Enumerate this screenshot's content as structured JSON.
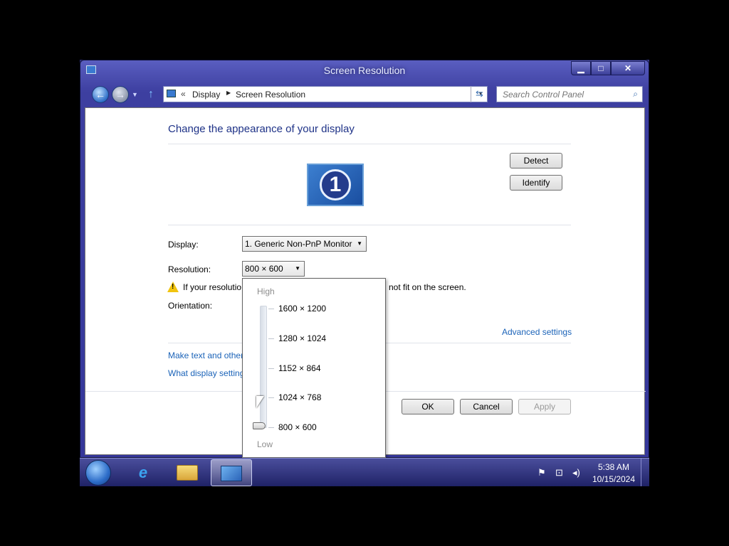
{
  "window": {
    "title": "Screen Resolution",
    "minimize_label": "▁",
    "maximize_label": "□",
    "close_label": "✕"
  },
  "nav": {
    "back_icon": "arrow-left-icon",
    "forward_icon": "arrow-right-icon",
    "breadcrumb": [
      "Display",
      "Screen Resolution"
    ],
    "search_placeholder": "Search Control Panel"
  },
  "main": {
    "heading": "Change the appearance of your display",
    "monitor_number": "1",
    "detect_label": "Detect",
    "identify_label": "Identify",
    "display_label": "Display:",
    "display_value": "1. Generic Non-PnP Monitor",
    "resolution_label": "Resolution:",
    "resolution_value": "800 × 600",
    "warning_prefix": "If your resolutio",
    "warning_suffix": "not fit on the screen.",
    "orientation_label": "Orientation:",
    "advanced_settings": "Advanced settings",
    "link_text_size": "Make text and other",
    "link_display_settings": "What display setting",
    "ok_label": "OK",
    "cancel_label": "Cancel",
    "apply_label": "Apply"
  },
  "resolution_popup": {
    "high_label": "High",
    "low_label": "Low",
    "options": [
      "1600 × 1200",
      "1280 × 1024",
      "1152 × 864",
      "1024 × 768",
      "800 × 600"
    ],
    "selected": "800 × 600"
  },
  "taskbar": {
    "time": "5:38 AM",
    "date": "10/15/2024",
    "pinned": [
      "internet-explorer-icon",
      "windows-explorer-icon",
      "control-panel-icon"
    ]
  }
}
